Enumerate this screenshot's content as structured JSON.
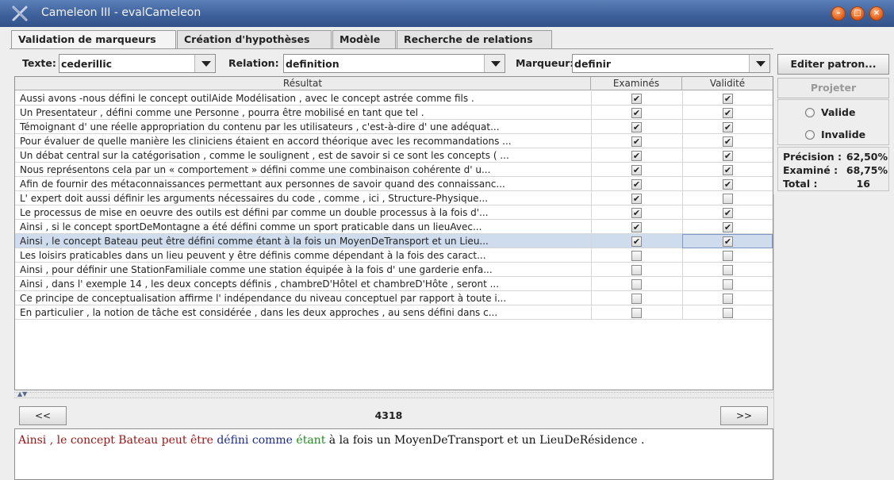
{
  "window": {
    "title": "Cameleon III - evalCameleon",
    "icon": "x-logo-icon"
  },
  "window_buttons": [
    {
      "name": "minimize",
      "glyph": "–"
    },
    {
      "name": "maximize",
      "glyph": "□"
    },
    {
      "name": "close",
      "glyph": "×"
    }
  ],
  "tabs": [
    {
      "label": "Validation de marqueurs"
    },
    {
      "label": "Création d'hypothèses"
    },
    {
      "label": "Modèle"
    },
    {
      "label": "Recherche de relations"
    }
  ],
  "filters": {
    "texte_label": "Texte:",
    "texte_value": "cederillic",
    "relation_label": "Relation:",
    "relation_value": "definition",
    "marqueur_label": "Marqueur:",
    "marqueur_value": "definir"
  },
  "table": {
    "headers": [
      "Résultat",
      "Examinés",
      "Validité"
    ],
    "rows": [
      {
        "text": "Aussi avons -nous   défini le concept outilAide Modélisation , avec le concept astrée comme  fils   .",
        "examines": true,
        "validite": true
      },
      {
        "text": "Un Presentateur ,   défini  comme  une   Personne , pourra être mobilisé en tant que tel .",
        "examines": true,
        "validite": true
      },
      {
        "text": "Témoignant d' une réelle appropriation du contenu par les utilisateurs , c'est-à-dire d' une adéquat...",
        "examines": true,
        "validite": true
      },
      {
        "text": "Pour évaluer de quelle manière les cliniciens étaient en accord théorique avec les recommandations ...",
        "examines": true,
        "validite": true
      },
      {
        "text": "Un débat central sur la catégorisation , comme le soulignent , est de savoir si ce sont les concepts ( ...",
        "examines": true,
        "validite": true
      },
      {
        "text": "Nous représentons cela par un « comportement »   défini  comme  une   combinaison cohérente d' u...",
        "examines": true,
        "validite": true
      },
      {
        "text": "Afin de fournir des métaconnaissances permettant aux personnes de savoir quand des connaissanc...",
        "examines": true,
        "validite": true
      },
      {
        "text": "L' expert doit aussi   définir les arguments nécessaires du code ,  comme  ,    ici , Structure-Physique...",
        "examines": true,
        "validite": false
      },
      {
        "text": "Le processus de mise en oeuvre des outils est   défini par comme  un   double processus à la fois d'...",
        "examines": true,
        "validite": true
      },
      {
        "text": "Ainsi , si le concept sportDeMontagne a été   défini  comme  un   sport praticable dans un lieuAvec...",
        "examines": true,
        "validite": true
      },
      {
        "text": "Ainsi , le concept Bateau peut être   défini  comme  étant   à la fois un MoyenDeTransport et un Lieu...",
        "examines": true,
        "validite": true,
        "selected": true
      },
      {
        "text": "Les loisirs praticables dans un lieu peuvent y être   définis  comme  dépendant   à la fois des caract...",
        "examines": false,
        "validite": false
      },
      {
        "text": "Ainsi , pour   définir une StationFamiliale comme  une   station équipée à la fois d' une garderie enfa...",
        "examines": false,
        "validite": false
      },
      {
        "text": "Ainsi , dans l' exemple 14 , les deux concepts définis , chambreD'Hôtel et chambreD'Hôte , seront ...",
        "examines": false,
        "validite": false
      },
      {
        "text": "Ce principe de conceptualisation affirme l' indépendance du niveau conceptuel par rapport à toute i...",
        "examines": false,
        "validite": false
      },
      {
        "text": "En particulier , la notion de tâche est considérée , dans les deux approches , au sens   défini dans c...",
        "examines": false,
        "validite": false
      }
    ],
    "check_glyph": "✔"
  },
  "nav": {
    "prev": "<<",
    "next": ">>",
    "counter": "4318"
  },
  "sentence": {
    "parts": [
      {
        "text": "Ainsi , le concept Bateau peut être ",
        "color": "#9b1414"
      },
      {
        "text": "défini comme ",
        "color": "#1c2a8a"
      },
      {
        "text": "étant ",
        "color": "#1f8a1f"
      },
      {
        "text": "à la fois un MoyenDeTransport et un LieuDeRésidence .",
        "color": "#111111"
      }
    ]
  },
  "right_panel": {
    "editer": "Editer patron...",
    "projeter": "Projeter",
    "valide": "Valide",
    "invalide": "Invalide",
    "precision_label": "Précision :",
    "precision_value": "62,50%",
    "examine_label": "Examiné :",
    "examine_value": "68,75%",
    "total_label": "Total :",
    "total_value": "16"
  },
  "colors": {
    "titlebar": "#3d5f99",
    "selected_row": "#cfdcee",
    "window_button": "#e05b14"
  }
}
